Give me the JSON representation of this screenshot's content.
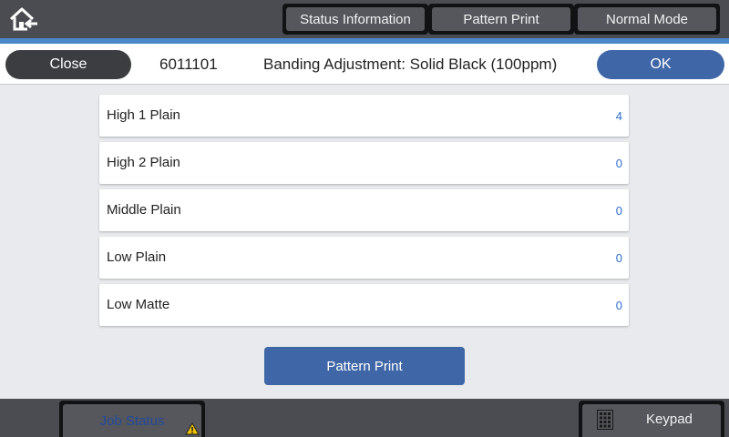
{
  "topbar": {
    "tabs": [
      {
        "label": "Status Information"
      },
      {
        "label": "Pattern Print"
      },
      {
        "label": "Normal Mode"
      }
    ]
  },
  "header": {
    "close_label": "Close",
    "code": "6011101",
    "title": "Banding Adjustment: Solid Black (100ppm)",
    "ok_label": "OK"
  },
  "settings": [
    {
      "label": "High 1 Plain",
      "value": "4"
    },
    {
      "label": "High 2 Plain",
      "value": "0"
    },
    {
      "label": "Middle Plain",
      "value": "0"
    },
    {
      "label": "Low Plain",
      "value": "0"
    },
    {
      "label": "Low Matte",
      "value": "0"
    }
  ],
  "main": {
    "pattern_print_label": "Pattern Print"
  },
  "bottombar": {
    "job_status_label": "Job Status",
    "keypad_label": "Keypad"
  },
  "colors": {
    "accent_blue": "#3f66a6",
    "value_blue": "#2e6dd0",
    "bar_gray": "#4a4c52",
    "warning_yellow": "#f2c200"
  },
  "icons": [
    "home-icon",
    "warning-icon",
    "keypad-icon"
  ]
}
